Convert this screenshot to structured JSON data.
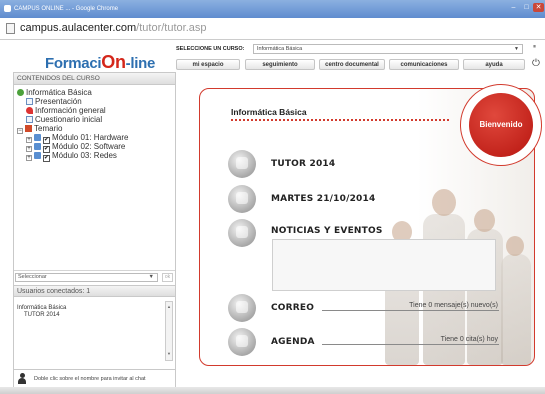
{
  "browser": {
    "title": "CAMPUS ONLINE ... - Google Chrome",
    "url_host": "campus.aulacenter.com",
    "url_path": "/tutor/tutor.asp",
    "win_minimize": "–",
    "win_maximize": "□",
    "win_close": "✕"
  },
  "header": {
    "logo_part1": "Formaci",
    "logo_part2": "On",
    "logo_part3": "-line",
    "course_label": "SELECCIONE UN CURSO:",
    "course_value": "Informática Básica",
    "course_arrow": "▼",
    "nav": [
      "mi espacio",
      "seguimiento",
      "centro documental",
      "comunicaciones",
      "ayuda"
    ],
    "icon_right1": "⏸",
    "icon_right2": "⏻"
  },
  "left_panel": {
    "contents_title": "CONTENIDOS DEL CURSO",
    "tree": {
      "root": "Informática Básica",
      "presentacion": "Presentación",
      "info_general": "Información general",
      "cuestionario": "Cuestionario inicial",
      "temario": "Temario",
      "modulos": [
        "Módulo 01: Hardware",
        "Módulo 02: Software",
        "Módulo 03: Redes"
      ],
      "check_mark": "✔",
      "expand_minus": "−",
      "expand_plus": "+"
    },
    "select_placeholder": "Seleccionar",
    "select_arrow": "▼",
    "select_ok": "ok",
    "users_title": "Usuarios conectados: 1",
    "users": [
      "Informática Básica",
      "TUTOR 2014"
    ],
    "scroll_up": "▲",
    "scroll_down": "▼",
    "chat_hint": "Doble clic sobre el nombre para invitar al chat"
  },
  "main": {
    "title": "Informática Básica",
    "badge": "Bienvenido",
    "rows": {
      "tutor": "TUTOR 2014",
      "date": "MARTES 21/10/2014",
      "news": "NOTICIAS Y EVENTOS",
      "correo": "CORREO",
      "correo_status": "Tiene 0 mensaje(s) nuevo(s)",
      "agenda": "AGENDA",
      "agenda_status": "Tiene 0 cita(s) hoy"
    }
  },
  "colors": {
    "accent_red": "#d23a2d",
    "logo_blue": "#2d6fb0",
    "chrome_blue": "#5f8ccf"
  }
}
